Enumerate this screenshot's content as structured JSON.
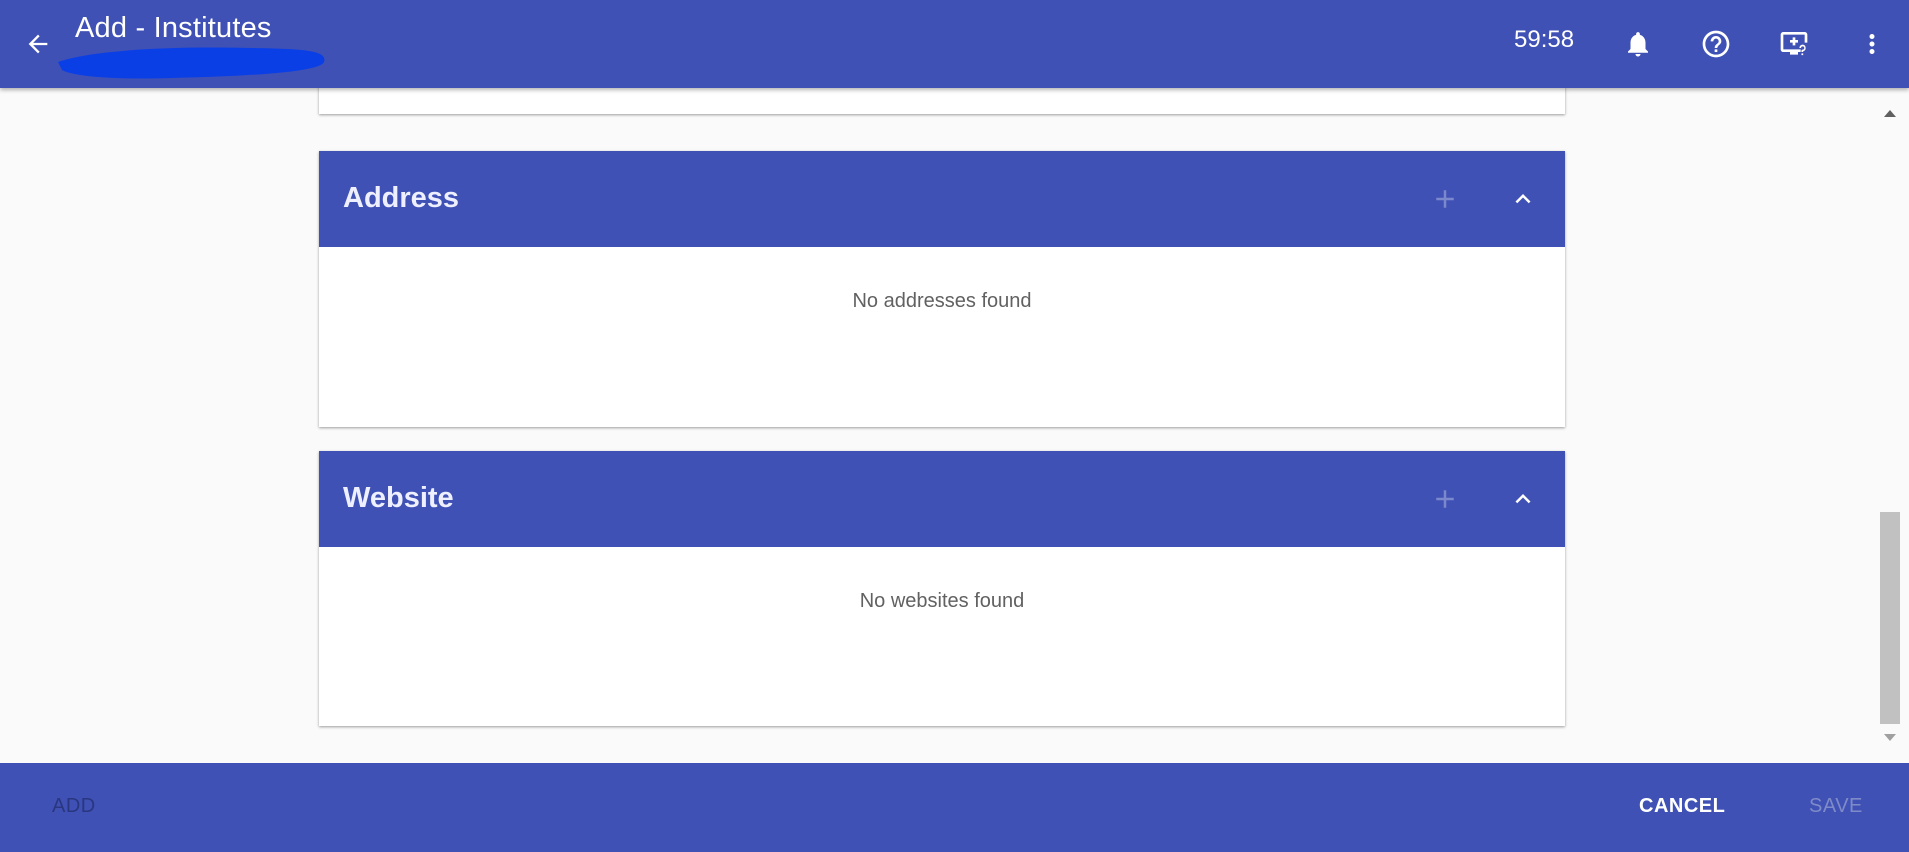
{
  "header": {
    "title": "Add - Institutes",
    "timer": "59:58",
    "back_icon": "arrow-back-icon",
    "icons": [
      "bell-icon",
      "help-circle-icon",
      "screen-share-icon",
      "more-vert-icon"
    ]
  },
  "sections": [
    {
      "title": "Address",
      "empty_message": "No addresses found"
    },
    {
      "title": "Website",
      "empty_message": "No websites found"
    }
  ],
  "footer": {
    "add_label": "ADD",
    "cancel_label": "CANCEL",
    "save_label": "SAVE"
  },
  "colors": {
    "primary": "#3f51b5",
    "background": "#fafafa",
    "card": "#ffffff"
  }
}
